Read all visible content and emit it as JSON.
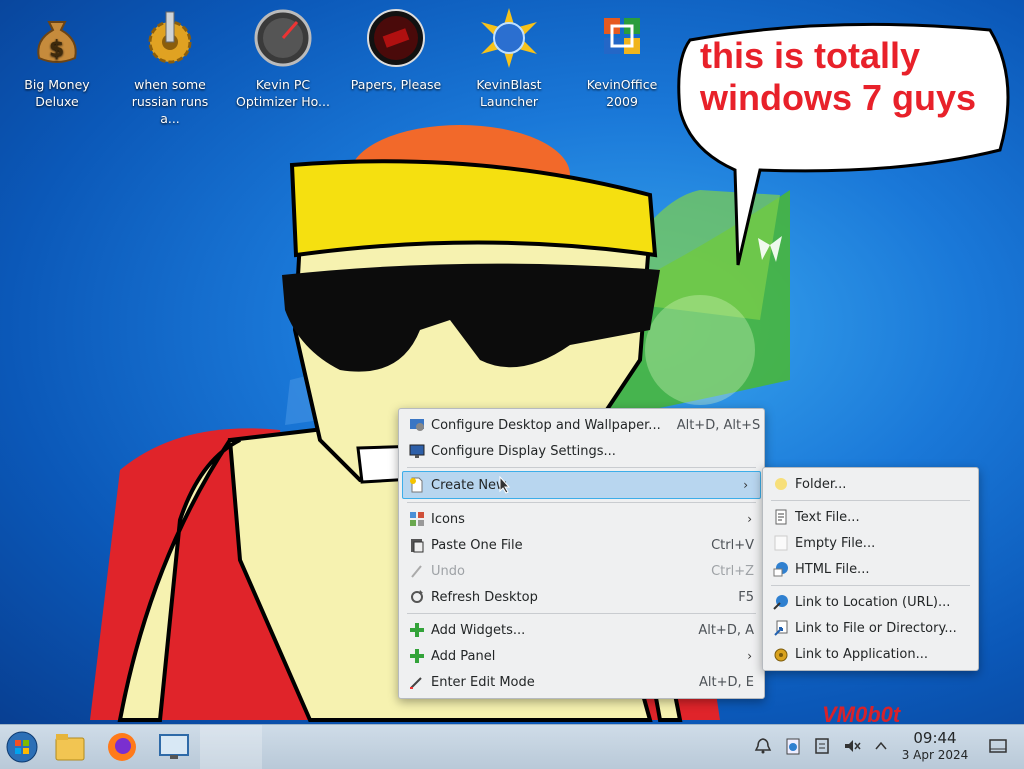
{
  "desktop_icons": [
    {
      "label": "Big Money Deluxe",
      "icon": "money-bag-icon"
    },
    {
      "label": "when some russian runs a...",
      "icon": "gear-icon"
    },
    {
      "label": "Kevin PC Optimizer Ho...",
      "icon": "speedometer-icon"
    },
    {
      "label": "Papers, Please",
      "icon": "papers-please-icon"
    },
    {
      "label": "KevinBlast Launcher",
      "icon": "globe-burst-icon"
    },
    {
      "label": "KevinOffice 2009",
      "icon": "office-logo-icon"
    }
  ],
  "speech_bubble": "this is totally windows 7 guys",
  "watermark": "VM0b0t",
  "context_menu": {
    "items": [
      {
        "label": "Configure Desktop and Wallpaper...",
        "shortcut": "Alt+D, Alt+S",
        "icon": "desktop-settings-icon"
      },
      {
        "label": "Configure Display Settings...",
        "shortcut": "",
        "icon": "display-icon"
      },
      {
        "label": "Create New",
        "shortcut": "",
        "icon": "new-document-icon",
        "submenu": true,
        "highlighted": true
      },
      {
        "label": "Icons",
        "shortcut": "",
        "icon": "icons-grid-icon",
        "submenu": true
      },
      {
        "label": "Paste One File",
        "shortcut": "Ctrl+V",
        "icon": "paste-icon"
      },
      {
        "label": "Undo",
        "shortcut": "Ctrl+Z",
        "icon": "undo-icon",
        "disabled": true
      },
      {
        "label": "Refresh Desktop",
        "shortcut": "F5",
        "icon": "refresh-icon"
      },
      {
        "label": "Add Widgets...",
        "shortcut": "Alt+D, A",
        "icon": "plus-icon"
      },
      {
        "label": "Add Panel",
        "shortcut": "",
        "icon": "plus-icon",
        "submenu": true
      },
      {
        "label": "Enter Edit Mode",
        "shortcut": "Alt+D, E",
        "icon": "edit-mode-icon"
      }
    ]
  },
  "submenu": {
    "items": [
      {
        "label": "Folder...",
        "icon": "folder-icon"
      },
      {
        "label": "Text File...",
        "icon": "text-file-icon"
      },
      {
        "label": "Empty File...",
        "icon": "empty-file-icon"
      },
      {
        "label": "HTML File...",
        "icon": "html-file-icon"
      },
      {
        "label": "Link to Location (URL)...",
        "icon": "url-link-icon"
      },
      {
        "label": "Link to File or Directory...",
        "icon": "file-link-icon"
      },
      {
        "label": "Link to Application...",
        "icon": "app-link-icon"
      }
    ]
  },
  "taskbar": {
    "buttons": [
      "start-orb-icon",
      "file-manager-icon",
      "firefox-icon",
      "remote-desktop-icon"
    ],
    "tray": [
      "notifications-bell-icon",
      "clipboard-icon",
      "storage-icon",
      "volume-muted-icon",
      "chevron-up-icon"
    ],
    "clock_time": "09:44",
    "clock_date": "3 Apr 2024",
    "show_desktop": "show-desktop-icon"
  }
}
